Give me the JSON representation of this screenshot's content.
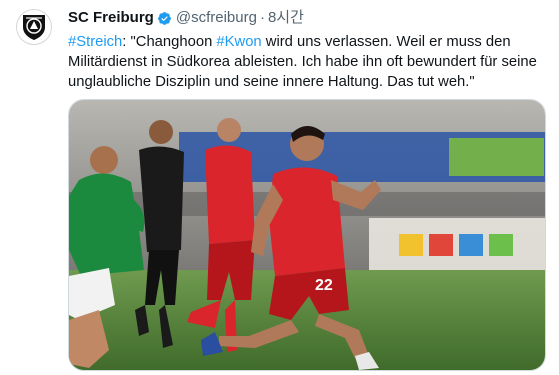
{
  "tweet": {
    "author_name": "SC Freiburg",
    "handle": "@scfreiburg",
    "separator": "·",
    "time": "8시간",
    "text": {
      "line1": {
        "hashtag1": "#Streich",
        "part1": ": \"Changhoon ",
        "hashtag2": "#Kwon",
        "part2": " wird uns verlassen. Weil er muss den"
      },
      "line2": "Militärdienst in Südkorea ableisten. Ich habe ihn oft bewundert für seine",
      "line3": "unglaubliche Disziplin und seine innere Haltung. Das tut weh.\""
    }
  },
  "photo": {
    "jersey_number": "22"
  },
  "colors": {
    "text": "#0f1419",
    "muted": "#536471",
    "accent": "#1d9bf0",
    "freiburg_red": "#d9252b",
    "bremen_green": "#1b8a3e"
  },
  "icons": {
    "avatar": "sc-freiburg-logo",
    "verified": "verified-badge-icon"
  }
}
